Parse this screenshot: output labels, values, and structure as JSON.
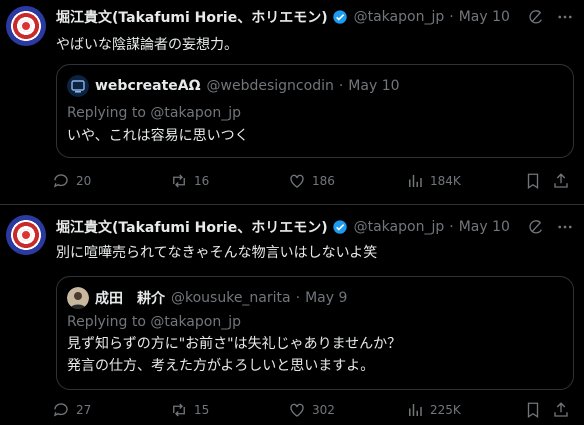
{
  "tweets": [
    {
      "author_name": "堀江貴文(Takafumi Horie、ホリエモン)",
      "handle": "@takapon_jp",
      "date": "May 10",
      "text": "やばいな陰謀論者の妄想力。",
      "quote": {
        "author_name": "webcreateAΩ",
        "handle": "@webdesigncodin",
        "date": "May 10",
        "replying": "Replying to @takapon_jp",
        "text_lines": [
          "いや、これは容易に思いつく"
        ]
      },
      "stats": {
        "replies": "20",
        "reposts": "16",
        "likes": "186",
        "views": "184K"
      }
    },
    {
      "author_name": "堀江貴文(Takafumi Horie、ホリエモン)",
      "handle": "@takapon_jp",
      "date": "May 10",
      "text": "別に喧嘩売られてなきゃそんな物言いはしないよ笑",
      "quote": {
        "author_name": "成田　耕介",
        "handle": "@kousuke_narita",
        "date": "May 9",
        "replying": "Replying to @takapon_jp",
        "text_lines": [
          "見ず知らずの方に\"お前さ\"は失礼じゃありませんか？",
          "発言の仕方、考えた方がよろしいと思いますよ。"
        ]
      },
      "stats": {
        "replies": "27",
        "reposts": "15",
        "likes": "302",
        "views": "225K"
      }
    }
  ],
  "colors": {
    "background": "#000000",
    "text": "#e7e9ea",
    "muted": "#71767b",
    "border": "#2f3336",
    "verified": "#1d9bf0"
  }
}
